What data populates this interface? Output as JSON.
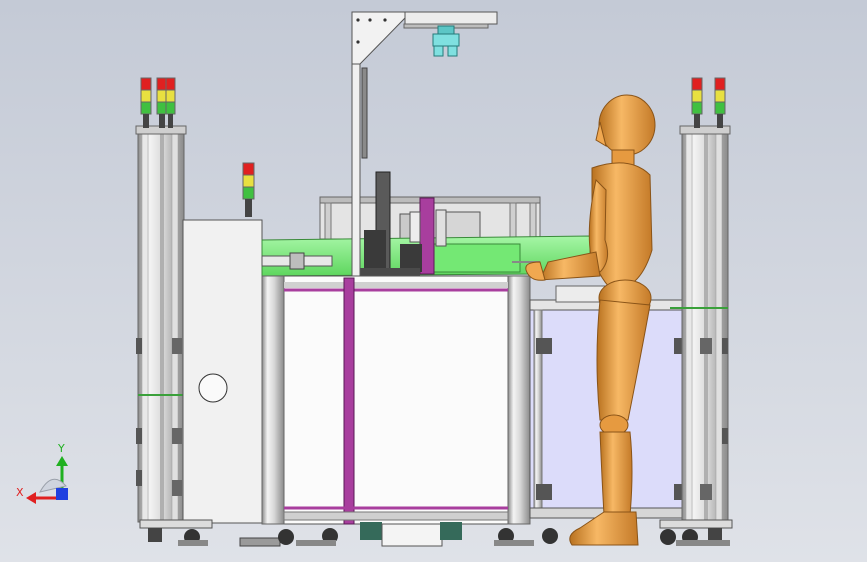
{
  "colors": {
    "background_top": "#c4cad6",
    "background_bottom": "#dfe2e8",
    "frame_light": "#f2f2f2",
    "frame_mid": "#c9c9c9",
    "frame_dark": "#7d7d7d",
    "green_conveyor": "#80f080",
    "magenta_profile": "#a83e9e",
    "panel_blue": "#dcdcfa",
    "mannequin": "#f0a850",
    "mannequin_shadow": "#b8711f",
    "cyan_gripper": "#7fe0e0",
    "light_red": "#e02020",
    "light_yellow": "#e8e040",
    "light_green": "#40c040",
    "axis_x": "#e02020",
    "axis_y": "#20b020",
    "axis_z": "#2040e0"
  },
  "triad": {
    "x_label": "X",
    "y_label": "Y"
  }
}
